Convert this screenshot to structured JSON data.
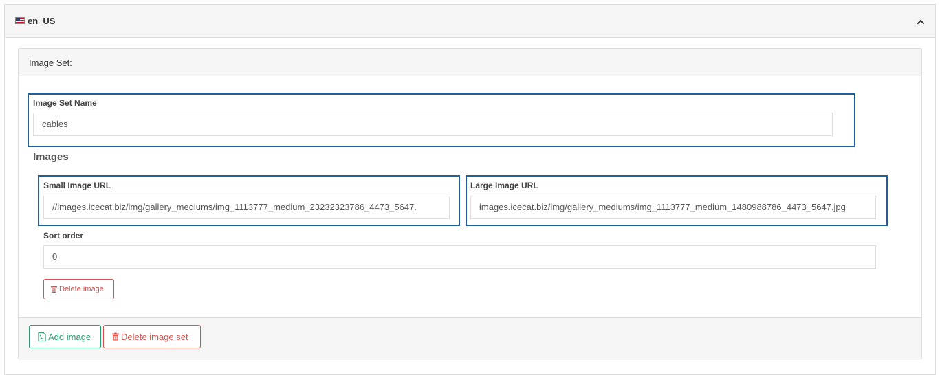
{
  "locale": {
    "code": "en_US",
    "flag_icon": "us-flag-icon",
    "collapse_icon": "chevron-up-icon"
  },
  "image_set": {
    "title": "Image Set:",
    "name_label": "Image Set Name",
    "name_value": "cables",
    "images_heading": "Images",
    "images": [
      {
        "small_url_label": "Small Image URL",
        "small_url_value": "//images.icecat.biz/img/gallery_mediums/img_1113777_medium_23232323786_4473_5647.",
        "large_url_label": "Large Image URL",
        "large_url_value": "images.icecat.biz/img/gallery_mediums/img_1113777_medium_1480988786_4473_5647.jpg",
        "sort_order_label": "Sort order",
        "sort_order_value": "0",
        "delete_label": "Delete image"
      }
    ],
    "add_image_label": "Add image",
    "delete_set_label": "Delete image set"
  },
  "colors": {
    "highlight_border": "#1f5f9f",
    "danger": "#d9534f",
    "success": "#2e9e6e",
    "panel_bg": "#f5f5f5"
  }
}
